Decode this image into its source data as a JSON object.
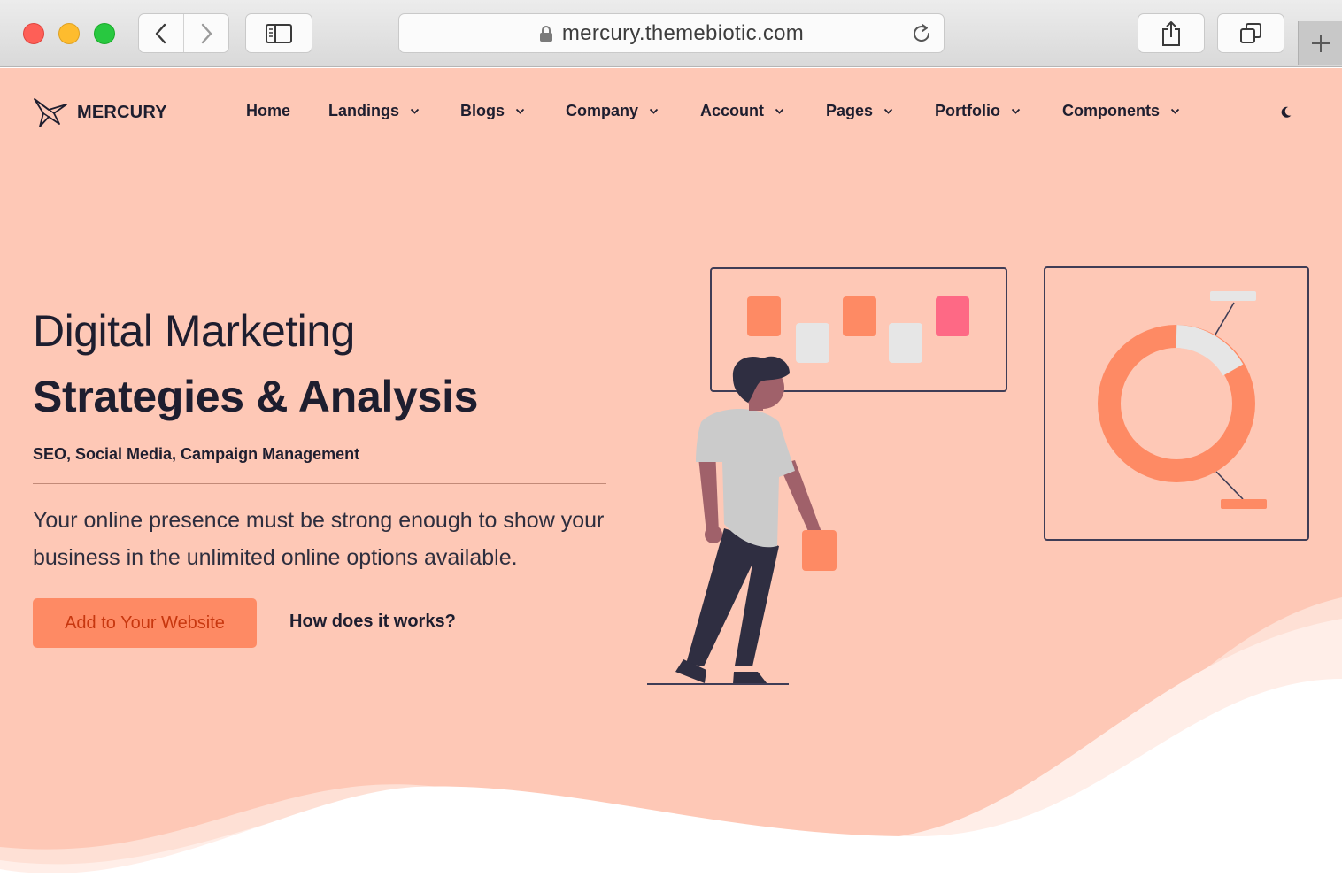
{
  "browser": {
    "url": "mercury.themebiotic.com",
    "icons": {
      "back": "chevron-left-icon",
      "forward": "chevron-right-icon",
      "sidebar": "sidebar-icon",
      "lock": "lock-icon",
      "reload": "reload-icon",
      "share": "share-icon",
      "tabs": "tabs-icon",
      "new_tab": "plus-icon"
    }
  },
  "site": {
    "brand": "MERCURY",
    "nav": [
      {
        "label": "Home",
        "dropdown": false
      },
      {
        "label": "Landings",
        "dropdown": true
      },
      {
        "label": "Blogs",
        "dropdown": true
      },
      {
        "label": "Company",
        "dropdown": true
      },
      {
        "label": "Account",
        "dropdown": true
      },
      {
        "label": "Pages",
        "dropdown": true
      },
      {
        "label": "Portfolio",
        "dropdown": true
      },
      {
        "label": "Components",
        "dropdown": true
      }
    ],
    "theme_toggle_icon": "moon-icon"
  },
  "hero": {
    "subtitle": "Digital Marketing",
    "title": "Strategies & Analysis",
    "tags": "SEO, Social Media, Campaign Management",
    "description": "Your online presence must be strong enough to show your business in the unlimited online options available.",
    "primary_button": "Add to Your Website",
    "secondary_link": "How does it works?"
  },
  "colors": {
    "background": "#fec8b6",
    "accent": "#fe8a64",
    "accent_text": "#c7370f",
    "text": "#1e1e2f",
    "note_pink": "#fe6985",
    "note_gray": "#e6e6e6"
  }
}
